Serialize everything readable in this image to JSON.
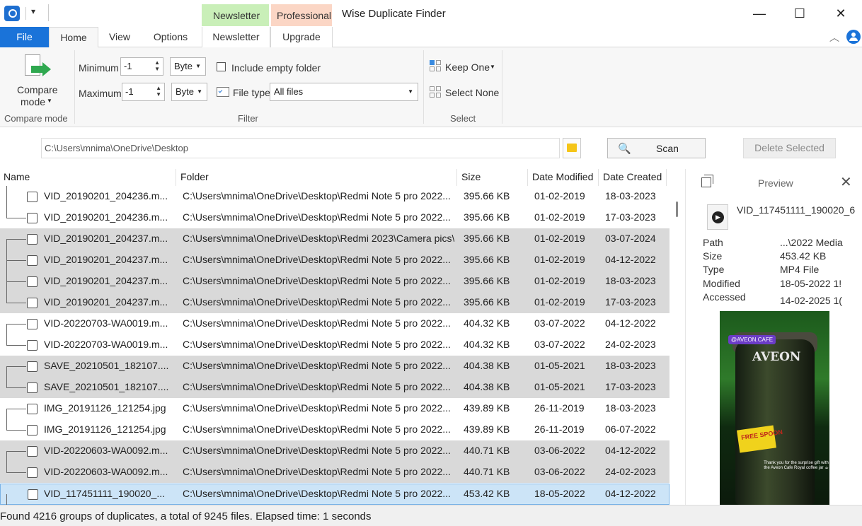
{
  "window": {
    "title": "Wise Duplicate Finder",
    "context_tab_newsletter": "Newsletter",
    "context_tab_professional": "Professional",
    "minimize": "—",
    "maximize": "☐",
    "close": "✕"
  },
  "tabs": [
    "File",
    "Home",
    "View",
    "Options",
    "Newsletter",
    "Upgrade"
  ],
  "ribbon": {
    "compare_mode_label": "Compare",
    "compare_mode_label2": "mode",
    "compare_mode_group": "Compare mode",
    "minimum_label": "Minimum",
    "maximum_label": "Maximum",
    "minimum_value": "-1",
    "maximum_value": "-1",
    "min_unit": "Byte",
    "max_unit": "Byte",
    "include_empty_folder": "Include empty folder",
    "file_type_label": "File type",
    "file_type_value": "All files",
    "filter_group": "Filter",
    "keep_one": "Keep One",
    "select_none": "Select None",
    "select_group": "Select"
  },
  "pathbar": {
    "path": "C:\\Users\\mnima\\OneDrive\\Desktop",
    "scan": "Scan",
    "delete_selected": "Delete Selected"
  },
  "columns": [
    "Name",
    "Folder",
    "Size",
    "Date Modified",
    "Date Created"
  ],
  "rows": [
    {
      "name": "VID_20190201_204236.m...",
      "folder": "C:\\Users\\mnima\\OneDrive\\Desktop\\Redmi Note 5 pro 2022...",
      "size": "395.66 KB",
      "modified": "01-02-2019",
      "created": "18-03-2023"
    },
    {
      "name": "VID_20190201_204236.m...",
      "folder": "C:\\Users\\mnima\\OneDrive\\Desktop\\Redmi Note 5 pro 2022...",
      "size": "395.66 KB",
      "modified": "01-02-2019",
      "created": "17-03-2023"
    },
    {
      "name": "VID_20190201_204237.m...",
      "folder": "C:\\Users\\mnima\\OneDrive\\Desktop\\Redmi 2023\\Camera pics\\",
      "size": "395.66 KB",
      "modified": "01-02-2019",
      "created": "03-07-2024"
    },
    {
      "name": "VID_20190201_204237.m...",
      "folder": "C:\\Users\\mnima\\OneDrive\\Desktop\\Redmi Note 5 pro 2022...",
      "size": "395.66 KB",
      "modified": "01-02-2019",
      "created": "04-12-2022"
    },
    {
      "name": "VID_20190201_204237.m...",
      "folder": "C:\\Users\\mnima\\OneDrive\\Desktop\\Redmi Note 5 pro 2022...",
      "size": "395.66 KB",
      "modified": "01-02-2019",
      "created": "18-03-2023"
    },
    {
      "name": "VID_20190201_204237.m...",
      "folder": "C:\\Users\\mnima\\OneDrive\\Desktop\\Redmi Note 5 pro 2022...",
      "size": "395.66 KB",
      "modified": "01-02-2019",
      "created": "17-03-2023"
    },
    {
      "name": "VID-20220703-WA0019.m...",
      "folder": "C:\\Users\\mnima\\OneDrive\\Desktop\\Redmi Note 5 pro 2022...",
      "size": "404.32 KB",
      "modified": "03-07-2022",
      "created": "04-12-2022"
    },
    {
      "name": "VID-20220703-WA0019.m...",
      "folder": "C:\\Users\\mnima\\OneDrive\\Desktop\\Redmi Note 5 pro 2022...",
      "size": "404.32 KB",
      "modified": "03-07-2022",
      "created": "24-02-2023"
    },
    {
      "name": "SAVE_20210501_182107....",
      "folder": "C:\\Users\\mnima\\OneDrive\\Desktop\\Redmi Note 5 pro 2022...",
      "size": "404.38 KB",
      "modified": "01-05-2021",
      "created": "18-03-2023"
    },
    {
      "name": "SAVE_20210501_182107....",
      "folder": "C:\\Users\\mnima\\OneDrive\\Desktop\\Redmi Note 5 pro 2022...",
      "size": "404.38 KB",
      "modified": "01-05-2021",
      "created": "17-03-2023"
    },
    {
      "name": "IMG_20191126_121254.jpg",
      "folder": "C:\\Users\\mnima\\OneDrive\\Desktop\\Redmi Note 5 pro 2022...",
      "size": "439.89 KB",
      "modified": "26-11-2019",
      "created": "18-03-2023"
    },
    {
      "name": "IMG_20191126_121254.jpg",
      "folder": "C:\\Users\\mnima\\OneDrive\\Desktop\\Redmi Note 5 pro 2022...",
      "size": "439.89 KB",
      "modified": "26-11-2019",
      "created": "06-07-2022"
    },
    {
      "name": "VID-20220603-WA0092.m...",
      "folder": "C:\\Users\\mnima\\OneDrive\\Desktop\\Redmi Note 5 pro 2022...",
      "size": "440.71 KB",
      "modified": "03-06-2022",
      "created": "04-12-2022"
    },
    {
      "name": "VID-20220603-WA0092.m...",
      "folder": "C:\\Users\\mnima\\OneDrive\\Desktop\\Redmi Note 5 pro 2022...",
      "size": "440.71 KB",
      "modified": "03-06-2022",
      "created": "24-02-2023"
    },
    {
      "name": "VID_117451111_190020_...",
      "folder": "C:\\Users\\mnima\\OneDrive\\Desktop\\Redmi Note 5 pro 2022...",
      "size": "453.42 KB",
      "modified": "18-05-2022",
      "created": "04-12-2022"
    }
  ],
  "preview": {
    "title": "Preview",
    "file_name": "VID_117451111_190020_6",
    "path_label": "Path",
    "path_value": "...\\2022 Media",
    "size_label": "Size",
    "size_value": "453.42 KB",
    "type_label": "Type",
    "type_value": "MP4 File",
    "modified_label": "Modified",
    "modified_value": "18-05-2022 1!",
    "accessed_label": "Accessed",
    "accessed_value": "14-02-2025 1(",
    "img_tag": "@AVEON.CAFE",
    "img_brand": "AVEON",
    "img_sticker": "FREE SPOON",
    "img_thanks": "Thank you for the surprise gift with the Aveon Cafe Royal coffee jar ☕"
  },
  "status": "Found 4216 groups of duplicates, a total of 9245 files. Elapsed time: 1 seconds"
}
